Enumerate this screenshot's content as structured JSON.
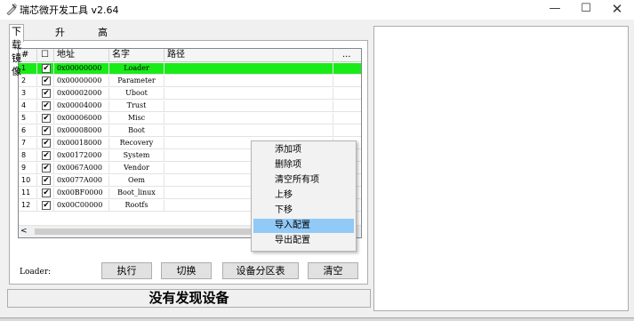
{
  "window": {
    "title": "瑞芯微开发工具 v2.64",
    "minimize_glyph": "—",
    "maximize_glyph": "☐",
    "close_glyph": "✕",
    "icon": "app-icon"
  },
  "tabs": [
    {
      "label": "下载镜像",
      "active": true
    },
    {
      "label": "升级固件",
      "active": false
    },
    {
      "label": "高级功能",
      "active": false
    }
  ],
  "table": {
    "headers": {
      "no": "#",
      "check": "☐",
      "address": "地址",
      "name": "名字",
      "path": "路径",
      "more": "..."
    },
    "rows": [
      {
        "no": "1",
        "checked": "✔",
        "address": "0x00000000",
        "name": "Loader",
        "path": "",
        "selected": true
      },
      {
        "no": "2",
        "checked": "✔",
        "address": "0x00000000",
        "name": "Parameter",
        "path": ""
      },
      {
        "no": "3",
        "checked": "✔",
        "address": "0x00002000",
        "name": "Uboot",
        "path": ""
      },
      {
        "no": "4",
        "checked": "✔",
        "address": "0x00004000",
        "name": "Trust",
        "path": ""
      },
      {
        "no": "5",
        "checked": "✔",
        "address": "0x00006000",
        "name": "Misc",
        "path": ""
      },
      {
        "no": "6",
        "checked": "✔",
        "address": "0x00008000",
        "name": "Boot",
        "path": ""
      },
      {
        "no": "7",
        "checked": "✔",
        "address": "0x00018000",
        "name": "Recovery",
        "path": ""
      },
      {
        "no": "8",
        "checked": "✔",
        "address": "0x00172000",
        "name": "System",
        "path": ""
      },
      {
        "no": "9",
        "checked": "✔",
        "address": "0x0067A000",
        "name": "Vendor",
        "path": ""
      },
      {
        "no": "10",
        "checked": "✔",
        "address": "0x0077A000",
        "name": "Oem",
        "path": ""
      },
      {
        "no": "11",
        "checked": "✔",
        "address": "0x00BF0000",
        "name": "Boot_linux",
        "path": ""
      },
      {
        "no": "12",
        "checked": "✔",
        "address": "0x00C00000",
        "name": "Rootfs",
        "path": ""
      }
    ],
    "scroll_left": "<"
  },
  "bottom": {
    "loader_label": "Loader:",
    "exec_button": "执行",
    "switch_button": "切换",
    "device_button": "设备分区表",
    "clear_button": "清空"
  },
  "status": "没有发现设备",
  "context_menu": [
    {
      "label": "添加项"
    },
    {
      "label": "删除项"
    },
    {
      "label": "清空所有项"
    },
    {
      "label": "上移"
    },
    {
      "label": "下移"
    },
    {
      "label": "导入配置",
      "hover": true
    },
    {
      "label": "导出配置"
    }
  ],
  "colors": {
    "selected_row": "#19eb19",
    "menu_hover": "#91c9f7"
  }
}
